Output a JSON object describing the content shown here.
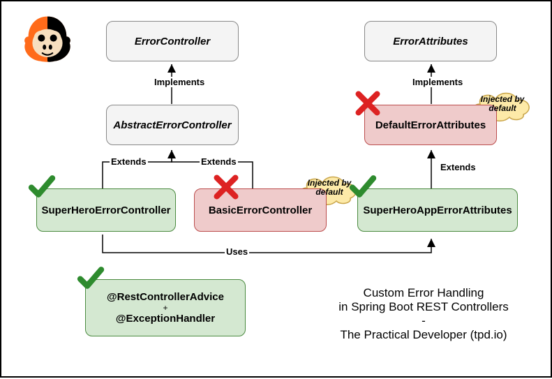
{
  "boxes": {
    "error_controller": "ErrorController",
    "error_attributes": "ErrorAttributes",
    "abstract_error_controller": "AbstractErrorController",
    "default_error_attributes": "DefaultErrorAttributes",
    "superhero_error_controller": "SuperHeroErrorController",
    "basic_error_controller": "BasicErrorController",
    "superhero_app_error_attributes": "SuperHeroAppErrorAttributes",
    "advice1": "@RestControllerAdvice",
    "advice_plus": "+",
    "advice2": "@ExceptionHandler"
  },
  "labels": {
    "implements1": "Implements",
    "implements2": "Implements",
    "extends1": "Extends",
    "extends2": "Extends",
    "extends3": "Extends",
    "uses": "Uses"
  },
  "clouds": {
    "injected1": "Injected by default",
    "injected2": "Injected by default"
  },
  "caption": {
    "line1": "Custom Error Handling",
    "line2": "in Spring Boot REST Controllers",
    "line3": "-",
    "line4": "The Practical Developer (tpd.io)"
  }
}
